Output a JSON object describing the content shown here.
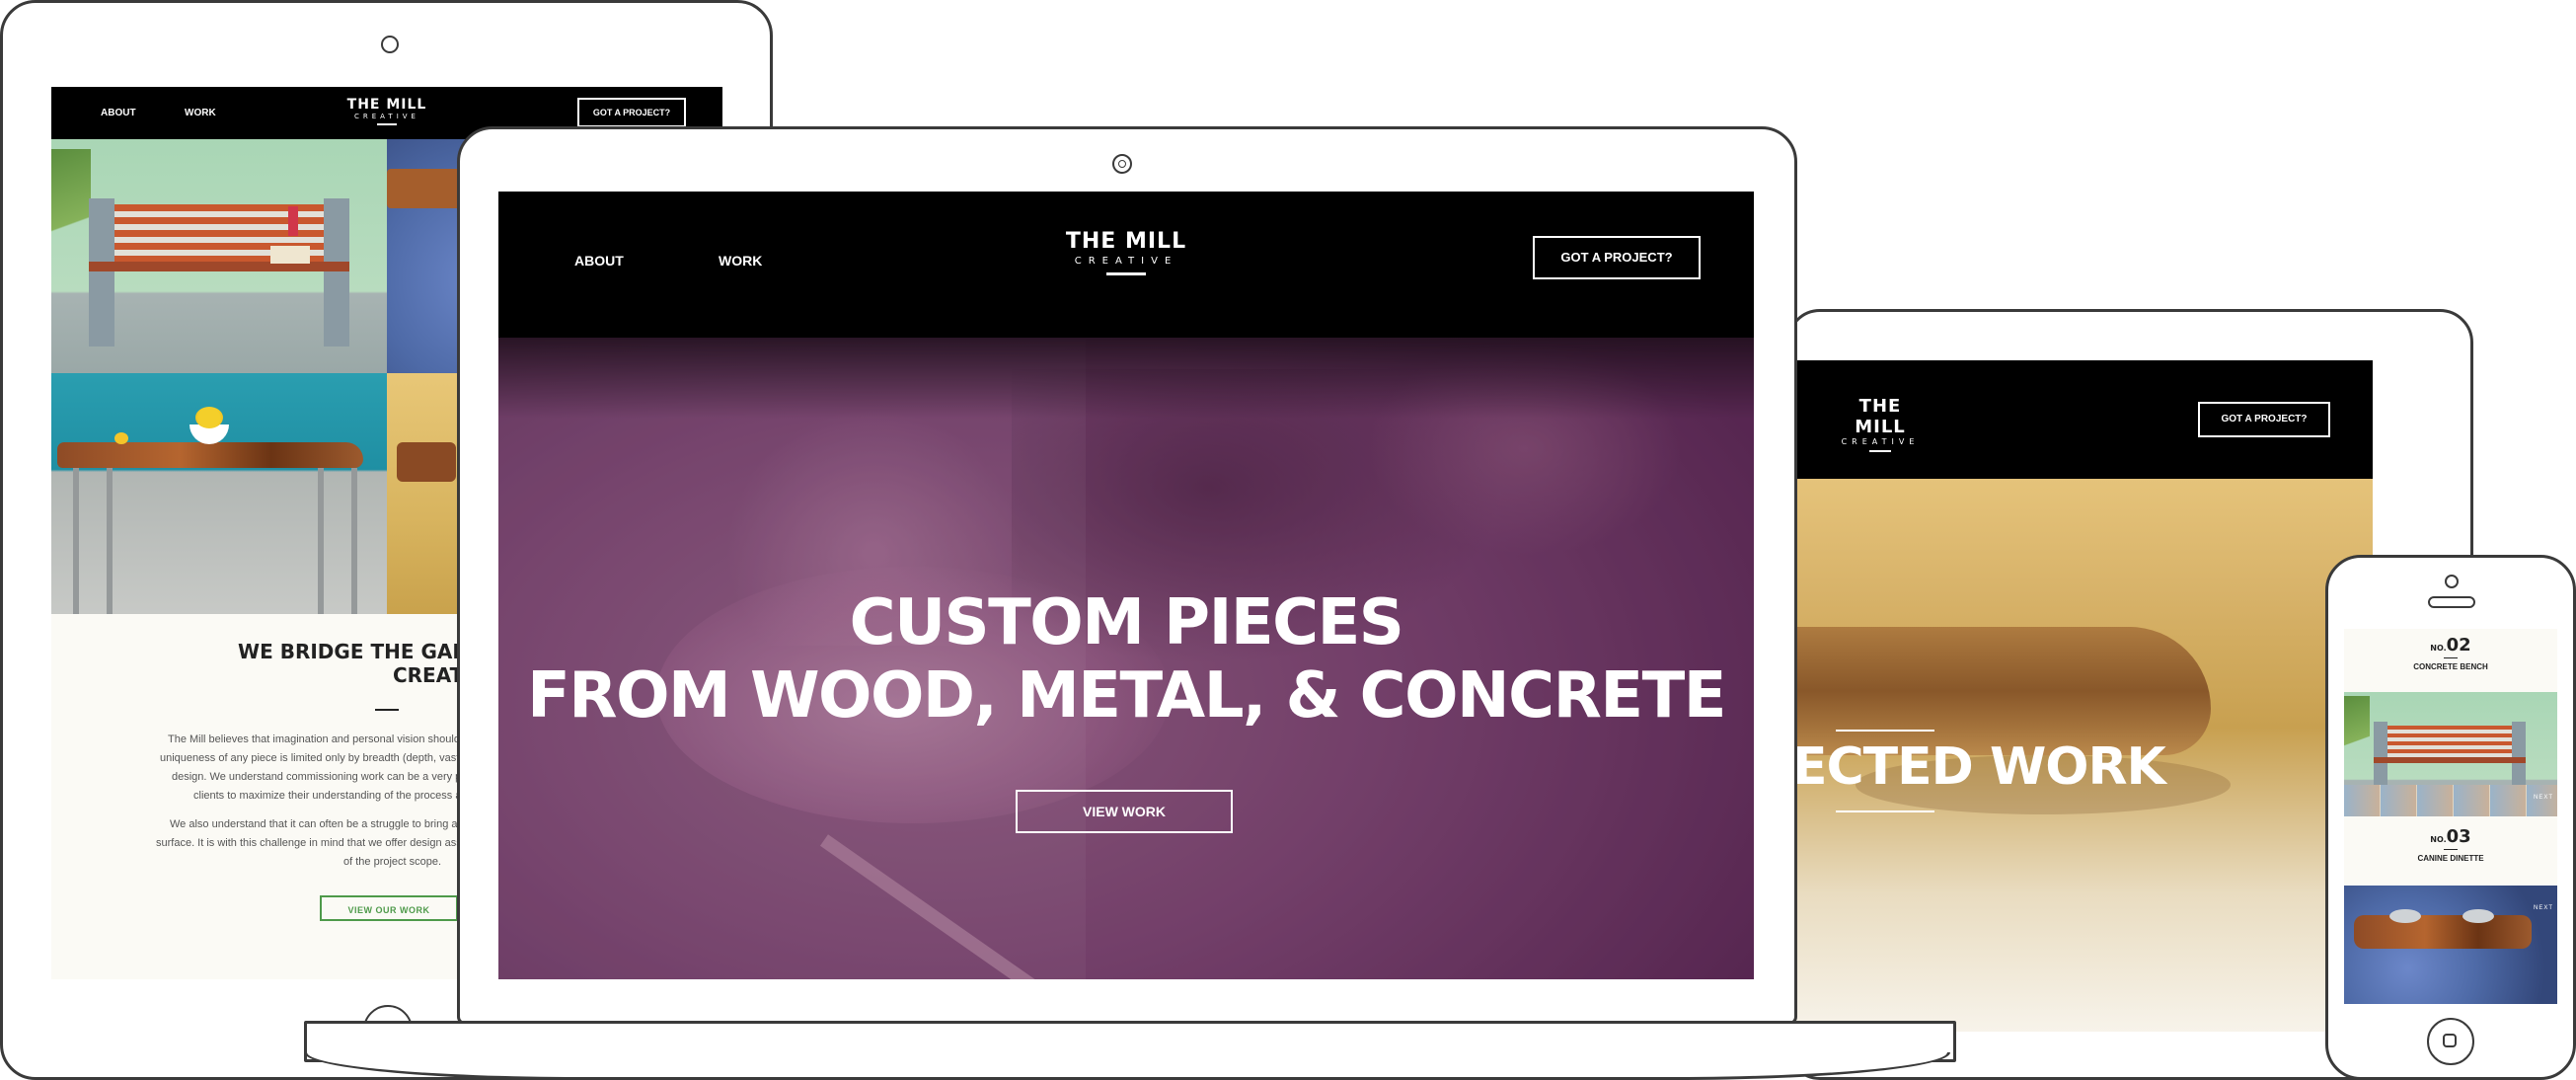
{
  "site": {
    "logo_line1": "THE MILL",
    "logo_line2": "CREATIVE",
    "nav_about": "ABOUT",
    "nav_work": "WORK",
    "cta": "GOT A PROJECT?"
  },
  "laptop": {
    "hero_line1": "CUSTOM PIECES",
    "hero_line2": "FROM WOOD, METAL, & CONCRETE",
    "view_work": "VIEW WORK"
  },
  "tablet": {
    "heading_line1": "WE BRIDGE THE GAP BETWEEN IM",
    "heading_line2": "CREATION.",
    "para1": [
      "The Mill believes that imagination and personal vision should g",
      "uniqueness of any piece is limited only by breadth (depth, vastne",
      "design. We understand commissioning work can be a very per",
      "clients to maximize their understanding of the process and"
    ],
    "para2": [
      "We also understand that it can often be a struggle to bring a de",
      "surface. It is with this challenge in mind that we offer design assi",
      "of the project scope."
    ],
    "view_our_work": "VIEW OUR WORK"
  },
  "tablet2": {
    "section_title": "ECTED WORK"
  },
  "phone": {
    "items": [
      {
        "no": "NO.",
        "num": "02",
        "name": "CONCRETE BENCH"
      },
      {
        "no": "NO.",
        "num": "03",
        "name": "CANINE DINETTE"
      }
    ],
    "next_label": "NEXT"
  },
  "colors": {
    "hero_overlay": "#7a3a6e",
    "accent_green": "#4e9a4a",
    "nav_bg": "#000000",
    "device_stroke": "#3a3a3a"
  }
}
